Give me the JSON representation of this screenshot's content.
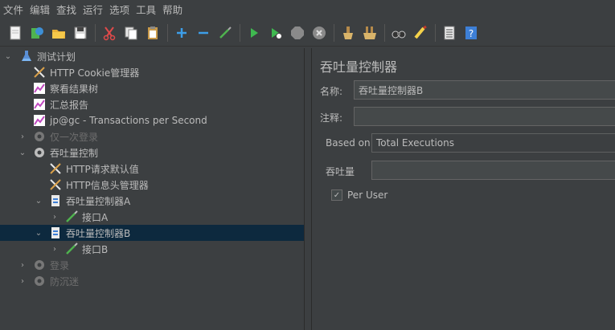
{
  "menu": [
    "文件",
    "编辑",
    "查找",
    "运行",
    "选项",
    "工具",
    "帮助"
  ],
  "toolbar": {
    "icons": [
      "new-icon",
      "templates-icon",
      "open-icon",
      "save-icon",
      "cut-icon",
      "copy-icon",
      "paste-icon",
      "expand-icon",
      "collapse-icon",
      "toggle-icon",
      "start-icon",
      "start-no-timers-icon",
      "stop-icon",
      "shutdown-icon",
      "clear-icon",
      "clear-all-icon",
      "search-icon",
      "reset-search-icon",
      "function-helper-icon",
      "help-icon"
    ]
  },
  "tree": {
    "items": [
      {
        "label": "测试计划",
        "icon": "flask-icon",
        "twist": "v",
        "disabled": false
      },
      {
        "label": "HTTP Cookie管理器",
        "icon": "wrench-icon",
        "twist": "",
        "disabled": false
      },
      {
        "label": "察看结果树",
        "icon": "graph-icon",
        "twist": "",
        "disabled": false
      },
      {
        "label": "汇总报告",
        "icon": "graph-icon",
        "twist": "",
        "disabled": false
      },
      {
        "label": "jp@gc - Transactions per Second",
        "icon": "graph-icon",
        "twist": "",
        "disabled": false
      },
      {
        "label": "仅一次登录",
        "icon": "gear-icon",
        "twist": ">",
        "disabled": true
      },
      {
        "label": "吞吐量控制",
        "icon": "gear-icon",
        "twist": "v",
        "disabled": false
      },
      {
        "label": "HTTP请求默认值",
        "icon": "wrench-icon",
        "twist": "",
        "disabled": false
      },
      {
        "label": "HTTP信息头管理器",
        "icon": "wrench-icon",
        "twist": "",
        "disabled": false
      },
      {
        "label": "吞吐量控制器A",
        "icon": "controller-icon",
        "twist": "v",
        "disabled": false
      },
      {
        "label": "接口A",
        "icon": "pipette-icon",
        "twist": ">",
        "disabled": false
      },
      {
        "label": "吞吐量控制器B",
        "icon": "controller-icon",
        "twist": "v",
        "disabled": false,
        "selected": true
      },
      {
        "label": "接口B",
        "icon": "pipette-icon",
        "twist": ">",
        "disabled": false
      },
      {
        "label": "登录",
        "icon": "gear-icon",
        "twist": ">",
        "disabled": true
      },
      {
        "label": "防沉迷",
        "icon": "gear-icon",
        "twist": ">",
        "disabled": true
      }
    ]
  },
  "panel": {
    "title": "吞吐量控制器",
    "name_label": "名称:",
    "name_value": "吞吐量控制器B",
    "comment_label": "注释:",
    "comment_value": "",
    "based_on_label": "Based on",
    "based_on_value": "Total Executions",
    "throughput_label": "吞吐量",
    "throughput_value": "",
    "per_user_label": "Per User",
    "per_user_checked": true
  }
}
